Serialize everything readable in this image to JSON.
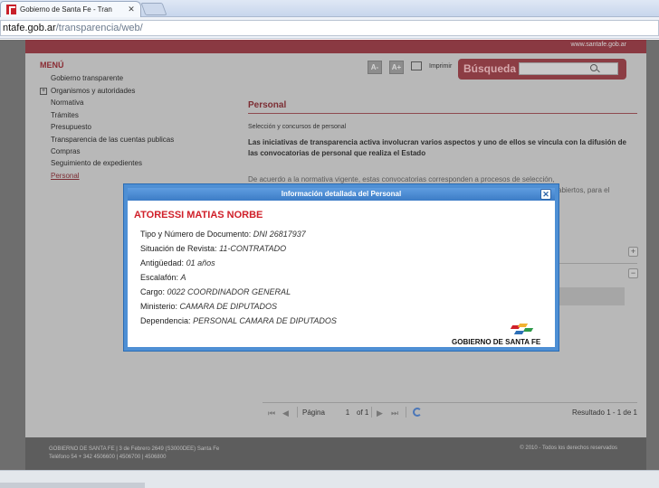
{
  "browser": {
    "tab_title": "Gobierno de Santa Fe - Tran",
    "tab_close": "✕",
    "url_host": "ntafe.gob.ar",
    "url_path": "/transparencia/web/"
  },
  "site": {
    "top_link": "www.santafe.gob.ar",
    "menu_title": "MENÚ",
    "menu_items": [
      "Gobierno transparente",
      "Organismos y autoridades",
      "Normativa",
      "Trámites",
      "Presupuesto",
      "Transparencia de las cuentas publicas",
      "Compras",
      "Seguimiento de expedientes",
      "Personal"
    ],
    "menu_expander": "+",
    "font_smaller": "A-",
    "font_larger": "A+",
    "print_label": "Imprimir",
    "search_label": "Búsqueda",
    "search_value": ""
  },
  "main": {
    "section_title": "Personal",
    "subtitle": "Selección y concursos de personal",
    "para1": "Las iniciativas de transparencia activa involucran varios aspectos y uno de ellos se vincula con la difusión de las convocatorias de personal que realiza el Estado",
    "para2_line1": "De acuerdo a la normativa vigente, estas convocatorias corresponden a procesos de selección,",
    "para2_line2": "abiertos, para el",
    "expand_plus": "+",
    "expand_minus": "−"
  },
  "pager": {
    "first": "⏮",
    "prev": "◀",
    "page_label": "Página",
    "page_value": "1",
    "of_label": "of 1",
    "next": "▶",
    "last": "⏭",
    "result": "Resultado 1 - 1 de 1"
  },
  "modal": {
    "title": "Información detallada del Personal",
    "close": "✕",
    "person_name": "ATORESSI MATIAS NORBE",
    "fields": [
      {
        "label": "Tipo y Número de Documento:",
        "value": "DNI 26817937"
      },
      {
        "label": "Situación de Revista:",
        "value": "11-CONTRATADO"
      },
      {
        "label": "Antigüedad:",
        "value": "01 años"
      },
      {
        "label": "Escalafón:",
        "value": "A"
      },
      {
        "label": "Cargo:",
        "value": "0022 COORDINADOR GENERAL"
      },
      {
        "label": "Ministerio:",
        "value": "CAMARA DE DIPUTADOS"
      },
      {
        "label": "Dependencia:",
        "value": "PERSONAL CAMARA DE DIPUTADOS"
      }
    ],
    "logo_text": "GOBIERNO DE SANTA FE"
  },
  "footer": {
    "line1": "GOBIERNO DE SANTA FE | 3 de Febrero 2649 (S3000DEE) Santa Fe",
    "line2": "Teléfono 54 + 342 4506600 | 4506700 | 4506800",
    "copyright": "© 2010 - Todos los derechos reservados"
  },
  "colors": {
    "brand_red": "#c8202a",
    "modal_blue": "#4e8fd4",
    "name_red": "#d0202a"
  }
}
